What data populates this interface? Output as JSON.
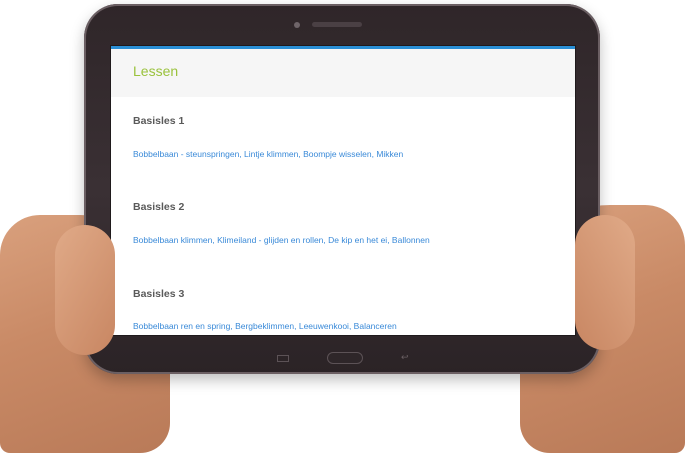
{
  "page": {
    "header_title": "Lessen"
  },
  "lessons": [
    {
      "title": "Basisles 1",
      "items": "Bobbelbaan - steunspringen, Lintje klimmen, Boompje wisselen, Mikken"
    },
    {
      "title": "Basisles 2",
      "items": "Bobbelbaan klimmen, Klimeiland - glijden en rollen, De kip en het ei, Ballonnen"
    },
    {
      "title": "Basisles 3",
      "items": "Bobbelbaan ren en spring, Bergbeklimmen, Leeuwenkooi, Balanceren"
    }
  ],
  "device": {
    "nav_icons": [
      "menu-icon",
      "home-button",
      "back-icon"
    ],
    "back_glyph": "↩"
  },
  "colors": {
    "accent_title": "#9ac23c",
    "link": "#3a8ad8",
    "header_border": "#2a8fd6"
  }
}
